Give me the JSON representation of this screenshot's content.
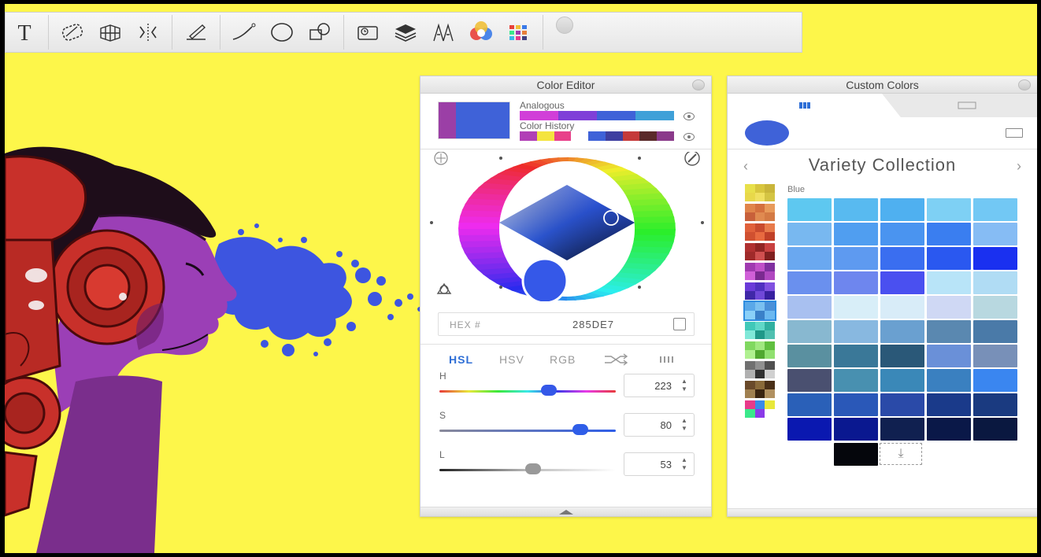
{
  "toolbar": {
    "tools": [
      {
        "name": "text-tool-icon",
        "glyph": "T"
      },
      {
        "name": "hatch-tool-icon"
      },
      {
        "name": "perspective-grid-icon"
      },
      {
        "name": "symmetry-icon"
      },
      {
        "name": "pen-ruler-icon"
      },
      {
        "name": "curve-icon"
      },
      {
        "name": "ellipse-icon"
      },
      {
        "name": "shapes-icon"
      },
      {
        "name": "flipbook-icon"
      },
      {
        "name": "layers-icon"
      },
      {
        "name": "brushes-icon"
      },
      {
        "name": "color-wheel-icon"
      },
      {
        "name": "color-grid-icon"
      }
    ]
  },
  "color_editor": {
    "title": "Color Editor",
    "current_color": "#3f62d8",
    "previous_color": "#9b3fa6",
    "analogous_label": "Analogous",
    "analogous_colors": [
      "#d13fd8",
      "#7f3fd8",
      "#3f62d8",
      "#3fa0d8"
    ],
    "history_label": "Color History",
    "history_colors": [
      "#b13fb6",
      "#f4e43f",
      "#e8418a",
      "#ffffff",
      "#3f62d8",
      "#3f3fa0",
      "#c53a3a",
      "#5a2a2a",
      "#8a3a8a"
    ],
    "hex_label": "HEX #",
    "hex_value": "285DE7",
    "modes": [
      "HSL",
      "HSV",
      "RGB"
    ],
    "active_mode": "HSL",
    "sliders": [
      {
        "label": "H",
        "value": "223",
        "fraction": 0.62
      },
      {
        "label": "S",
        "value": "80",
        "fraction": 0.8
      },
      {
        "label": "L",
        "value": "53",
        "fraction": 0.53
      }
    ]
  },
  "custom_colors": {
    "title": "Custom Colors",
    "current_color": "#3f62d8",
    "collection_title": "Variety Collection",
    "group_label": "Blue",
    "prev_glyph": "‹",
    "next_glyph": "›",
    "drop_glyph": "⤓",
    "collections": [
      [
        "#e8e04a",
        "#d8c63e",
        "#c9b53a",
        "#e8d84a",
        "#f0e060",
        "#d4c443"
      ],
      [
        "#e0844a",
        "#d4703e",
        "#e89a5a",
        "#c8603a",
        "#e08a50",
        "#d47a44"
      ],
      [
        "#e0603a",
        "#c84a2e",
        "#e87a4a",
        "#d05030",
        "#e86a40",
        "#c04028"
      ],
      [
        "#b03030",
        "#902424",
        "#c84040",
        "#a02a2a",
        "#d05050",
        "#802020"
      ],
      [
        "#a03ab0",
        "#c050c8",
        "#8030a0",
        "#d060d8",
        "#7a2a90",
        "#b048c0"
      ],
      [
        "#6a3ad8",
        "#5030c0",
        "#8050e0",
        "#4028a8",
        "#7048d8",
        "#3820a0"
      ],
      [
        "#5aa8e8",
        "#7ac0f0",
        "#4a90d8",
        "#8ad0f8",
        "#3a80c8",
        "#6ab8f0"
      ],
      [
        "#40c8b8",
        "#60d8c8",
        "#30b0a0",
        "#80e8d8",
        "#209888",
        "#50c0b0"
      ],
      [
        "#80d860",
        "#a0e880",
        "#60c040",
        "#b0f090",
        "#50a830",
        "#90e070"
      ],
      [
        "#707070",
        "#909090",
        "#505050",
        "#b0b0b0",
        "#303030",
        "#d0d0d0"
      ],
      [
        "#6a4a2a",
        "#8a6a3a",
        "#4a3018",
        "#a08050",
        "#3a2410",
        "#b09060"
      ],
      [
        "#e83a8a",
        "#3a8ae8",
        "#e8e83a",
        "#3ae88a",
        "#8a3ae8",
        "#ffffff"
      ]
    ],
    "selected_collection": 6,
    "grid": [
      [
        "#5ec8f0",
        "#58baf0",
        "#4fb0f0",
        "#7ed0f4",
        "#72c8f4"
      ],
      [
        "#78b8f0",
        "#509ef0",
        "#4a94f0",
        "#3a7ef0",
        "#86bcf4"
      ],
      [
        "#6aa8f0",
        "#5e9af0",
        "#3a6ef0",
        "#2a58f0",
        "#1a30f0"
      ],
      [
        "#6a90ee",
        "#6e86ee",
        "#4a50f0",
        "#b8e4f8",
        "#b0dcf4"
      ],
      [
        "#a8c0f0",
        "#d8eef8",
        "#d8ecf8",
        "#cfd8f4",
        "#b8d8e0"
      ],
      [
        "#88b8d0",
        "#88b8e0",
        "#6aa0d0",
        "#5a88b0",
        "#4a7aa8"
      ],
      [
        "#5a90a0",
        "#3a7898",
        "#2a5878",
        "#6a90d8",
        "#7890b8"
      ],
      [
        "#4a5070",
        "#4890b0",
        "#3a88b8",
        "#3a80c0",
        "#3a86f0"
      ],
      [
        "#2a60b8",
        "#2a58b8",
        "#2a4aa8",
        "#1a3a8a",
        "#1a3a80"
      ],
      [
        "#0a18b0",
        "#0a1890",
        "#102050",
        "#0a1848",
        "#0a1840"
      ]
    ],
    "extra_swatch": "#05060c"
  }
}
